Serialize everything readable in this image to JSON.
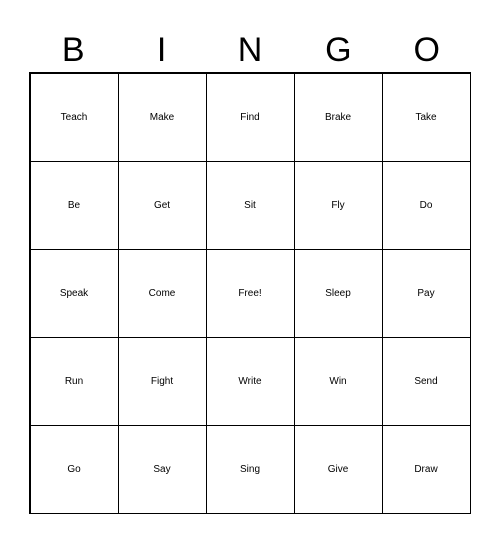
{
  "header": [
    "B",
    "I",
    "N",
    "G",
    "O"
  ],
  "cells": [
    [
      "Teach",
      "Make",
      "Find",
      "Brake",
      "Take"
    ],
    [
      "Be",
      "Get",
      "Sit",
      "Fly",
      "Do"
    ],
    [
      "Speak",
      "Come",
      "Free!",
      "Sleep",
      "Pay"
    ],
    [
      "Run",
      "Fight",
      "Write",
      "Win",
      "Send"
    ],
    [
      "Go",
      "Say",
      "Sing",
      "Give",
      "Draw"
    ]
  ]
}
